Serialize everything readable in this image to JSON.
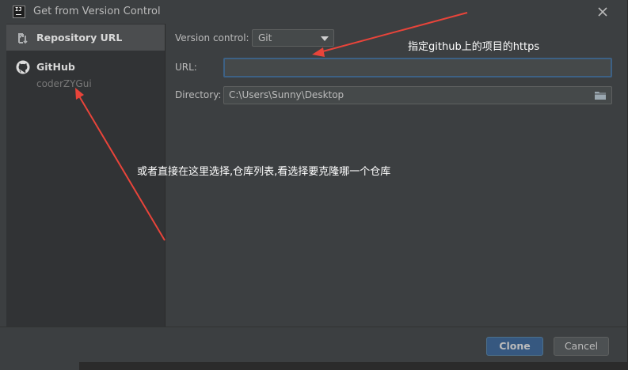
{
  "window": {
    "title": "Get from Version Control",
    "logo_text": "IJ"
  },
  "sidebar": {
    "items": [
      {
        "label": "Repository URL",
        "icon": "vcs-icon",
        "selected": true
      },
      {
        "label": "GitHub",
        "icon": "github-icon",
        "account": "coderZYGui"
      }
    ]
  },
  "form": {
    "version_control_label": "Version control:",
    "version_control_value": "Git",
    "url_label": "URL:",
    "url_value": "",
    "directory_label": "Directory:",
    "directory_value": "C:\\Users\\Sunny\\Desktop"
  },
  "buttons": {
    "clone": "Clone",
    "cancel": "Cancel"
  },
  "annotations": {
    "url_hint": "指定github上的项目的https",
    "github_hint": "或者直接在这里选择,仓库列表,看选择要克隆哪一个仓库"
  },
  "colors": {
    "accent": "#365880",
    "focus": "#3d6185",
    "annotation_arrow": "#e8443a",
    "background": "#3c3f41"
  }
}
